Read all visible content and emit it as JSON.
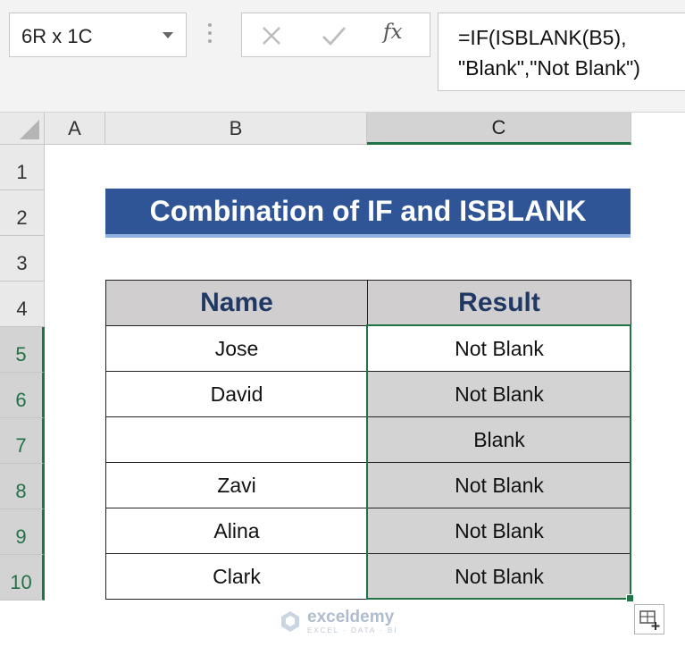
{
  "formula_bar": {
    "name_box": "6R x 1C",
    "fx_label": "fx",
    "formula_line1": "=IF(ISBLANK(B5),",
    "formula_line2": "\"Blank\",\"Not Blank\")"
  },
  "columns": [
    "A",
    "B",
    "C"
  ],
  "selected_column": "C",
  "rows": [
    "1",
    "2",
    "3",
    "4",
    "5",
    "6",
    "7",
    "8",
    "9",
    "10"
  ],
  "selected_rows": [
    "5",
    "6",
    "7",
    "8",
    "9",
    "10"
  ],
  "title": "Combination of IF and ISBLANK",
  "table": {
    "headers": [
      "Name",
      "Result"
    ],
    "rows": [
      {
        "name": "Jose",
        "result": "Not Blank"
      },
      {
        "name": "David",
        "result": "Not Blank"
      },
      {
        "name": "",
        "result": "Blank"
      },
      {
        "name": "Zavi",
        "result": "Not Blank"
      },
      {
        "name": "Alina",
        "result": "Not Blank"
      },
      {
        "name": "Clark",
        "result": "Not Blank"
      }
    ]
  },
  "watermark": {
    "name": "exceldemy",
    "tagline": "EXCEL · DATA · BI"
  },
  "colors": {
    "title_banner": "#2f5597",
    "header_fill": "#d0cece",
    "header_text": "#1f3864",
    "result_fill": "#d3d3d3",
    "selection": "#217346"
  }
}
